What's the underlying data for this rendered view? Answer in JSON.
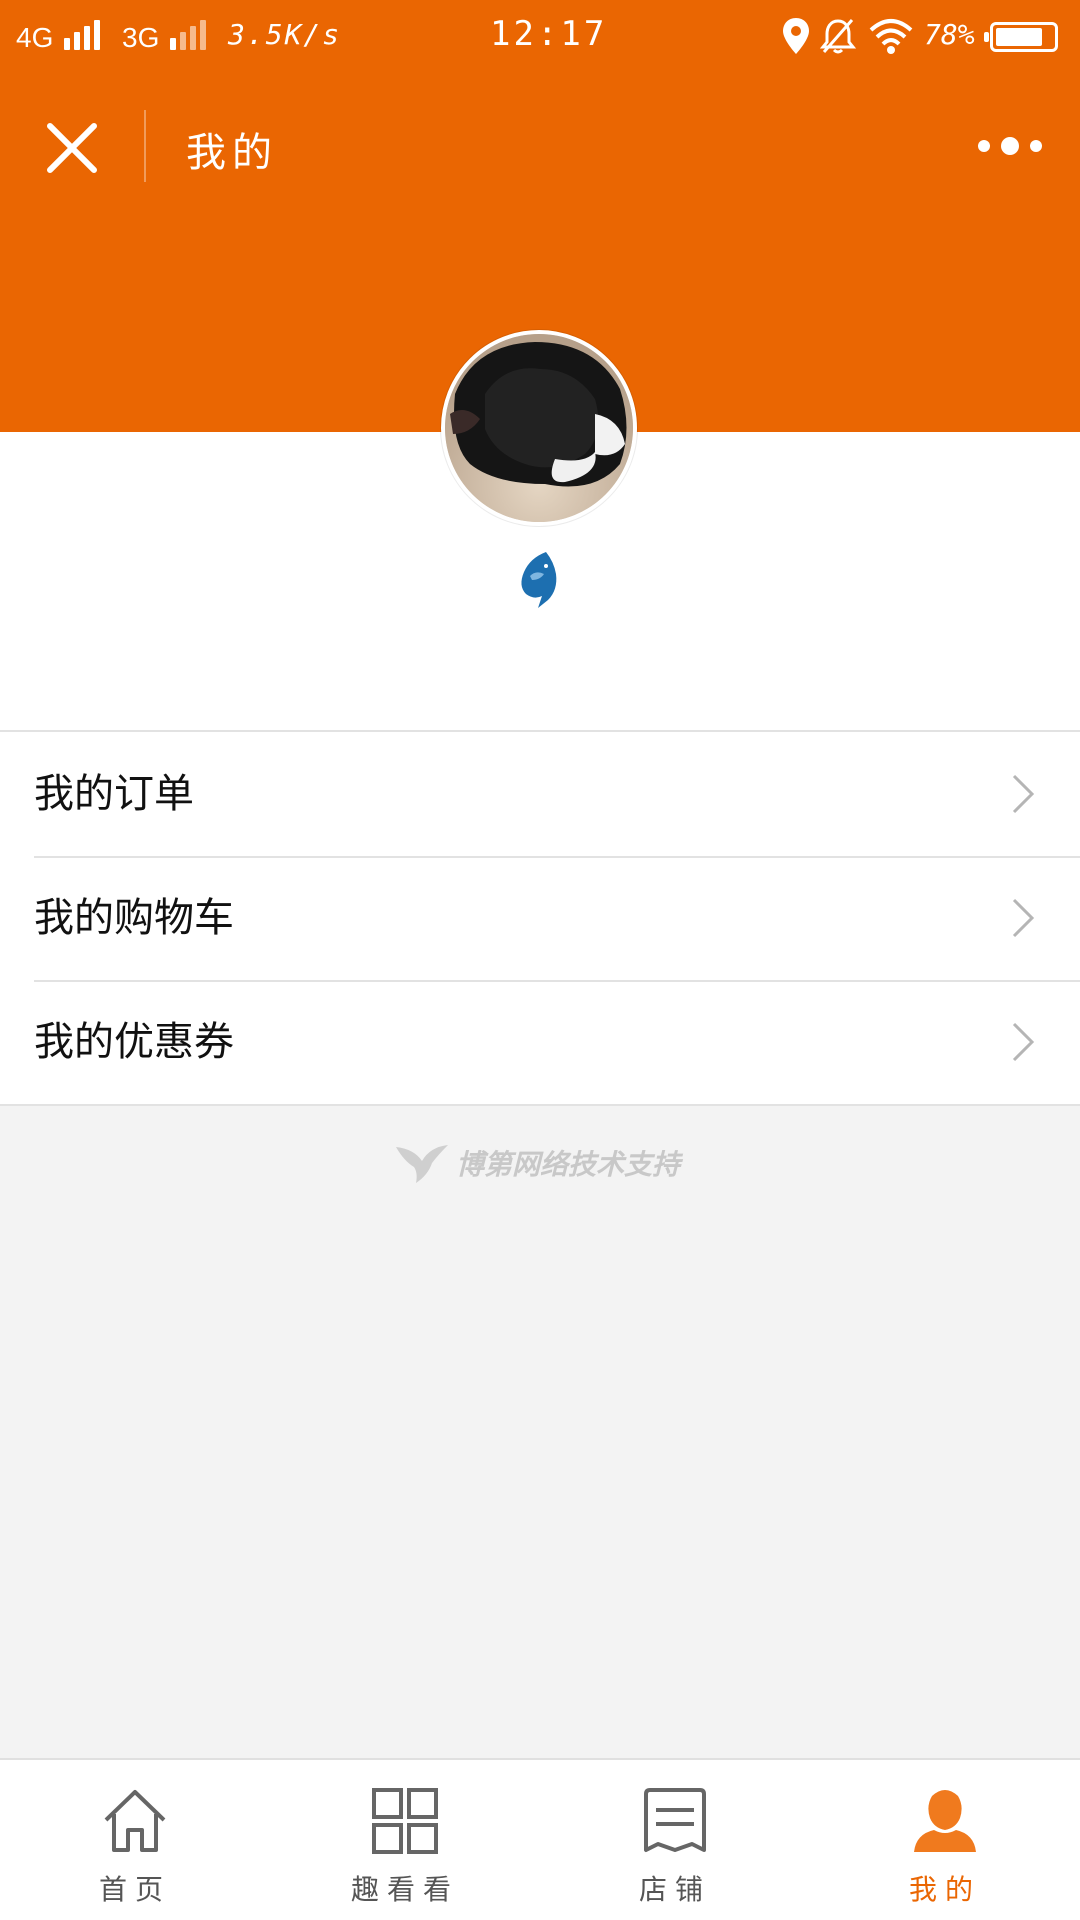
{
  "colors": {
    "brand": "#ea6602",
    "background": "#f3f3f3",
    "text": "#111111",
    "muted": "#c8c8c8"
  },
  "status_bar": {
    "network_1": "4G",
    "network_2": "3G",
    "speed": "3.5K/s",
    "time": "12:17",
    "battery": "78%",
    "icons": [
      "location-icon",
      "alarm-off-icon",
      "wifi-icon",
      "battery-icon"
    ]
  },
  "nav": {
    "title": "我的",
    "close_icon": "close-icon",
    "more_icon": "more-icon"
  },
  "profile": {
    "avatar_icon": "cat-avatar",
    "brand_icon": "dolphin-icon"
  },
  "menu": {
    "items": [
      {
        "label": "我的订单",
        "icon": "chevron-right-icon"
      },
      {
        "label": "我的购物车",
        "icon": "chevron-right-icon"
      },
      {
        "label": "我的优惠券",
        "icon": "chevron-right-icon"
      }
    ]
  },
  "footer": {
    "support_text": "博第网络技术支持",
    "support_icon": "hummingbird-icon"
  },
  "tabs": [
    {
      "label": "首页",
      "icon": "home-icon",
      "active": false
    },
    {
      "label": "趣看看",
      "icon": "grid-icon",
      "active": false
    },
    {
      "label": "店铺",
      "icon": "store-icon",
      "active": false
    },
    {
      "label": "我的",
      "icon": "user-icon",
      "active": true
    }
  ]
}
